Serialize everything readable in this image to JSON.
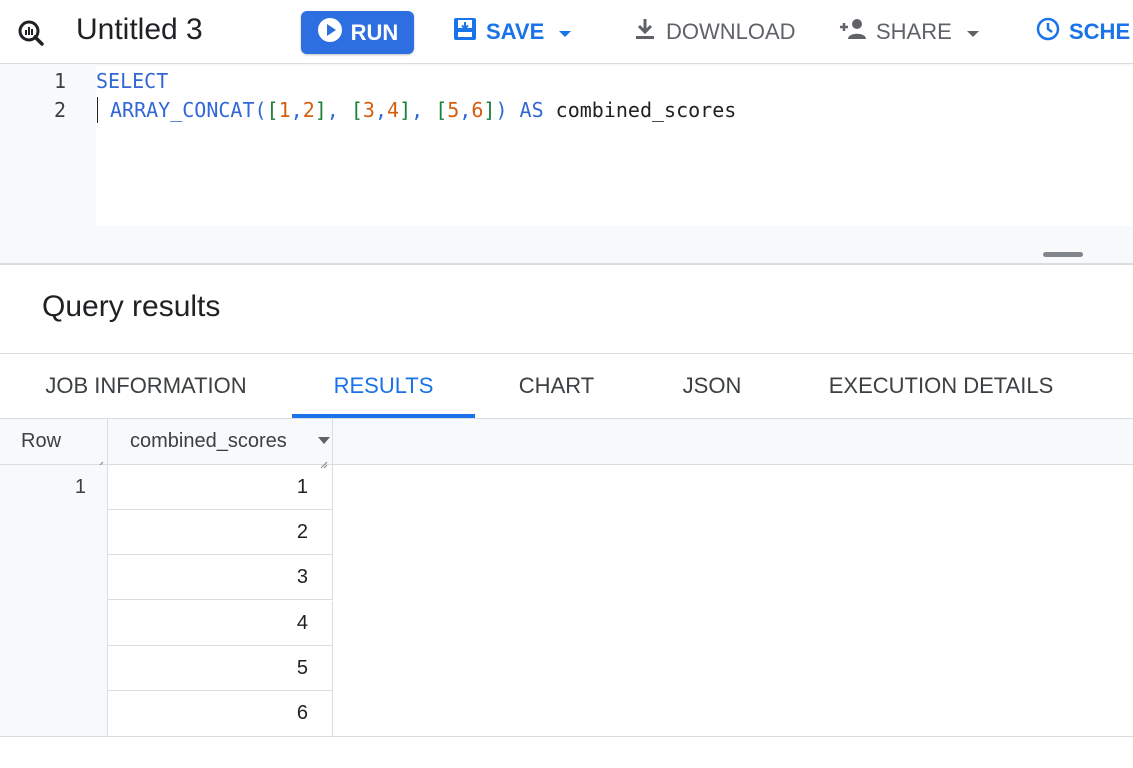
{
  "toolbar": {
    "title": "Untitled 3",
    "run_label": "RUN",
    "save_label": "SAVE",
    "download_label": "DOWNLOAD",
    "share_label": "SHARE",
    "schedule_label": "SCHE",
    "icons": [
      "query-icon",
      "play-icon",
      "save-icon",
      "chevron-down-icon",
      "download-icon",
      "add-person-icon",
      "clock-icon"
    ]
  },
  "editor": {
    "lines": [
      {
        "number": "1",
        "tokens": [
          {
            "t": "SELECT",
            "c": "kw"
          }
        ]
      },
      {
        "number": "2",
        "tokens": [
          {
            "t": "ARRAY_CONCAT",
            "c": "fn"
          },
          {
            "t": "(",
            "c": "kw"
          },
          {
            "t": "[",
            "c": "br"
          },
          {
            "t": "1",
            "c": "num"
          },
          {
            "t": ",",
            "c": "kw"
          },
          {
            "t": "2",
            "c": "num"
          },
          {
            "t": "]",
            "c": "br"
          },
          {
            "t": ", ",
            "c": "kw"
          },
          {
            "t": "[",
            "c": "br"
          },
          {
            "t": "3",
            "c": "num"
          },
          {
            "t": ",",
            "c": "kw"
          },
          {
            "t": "4",
            "c": "num"
          },
          {
            "t": "]",
            "c": "br"
          },
          {
            "t": ", ",
            "c": "kw"
          },
          {
            "t": "[",
            "c": "br"
          },
          {
            "t": "5",
            "c": "num"
          },
          {
            "t": ",",
            "c": "kw"
          },
          {
            "t": "6",
            "c": "num"
          },
          {
            "t": "]",
            "c": "br"
          },
          {
            "t": ")",
            "c": "kw"
          },
          {
            "t": " AS ",
            "c": "kw"
          },
          {
            "t": "combined_scores",
            "c": "pl"
          }
        ]
      }
    ]
  },
  "results": {
    "title": "Query results",
    "tabs": [
      {
        "label": "JOB INFORMATION",
        "active": false
      },
      {
        "label": "RESULTS",
        "active": true
      },
      {
        "label": "CHART",
        "active": false
      },
      {
        "label": "JSON",
        "active": false
      },
      {
        "label": "EXECUTION DETAILS",
        "active": false
      }
    ],
    "table": {
      "row_header": "Row",
      "column_header": "combined_scores",
      "row_number": "1",
      "values": [
        "1",
        "2",
        "3",
        "4",
        "5",
        "6"
      ]
    }
  },
  "colors": {
    "accent": "#1a73e8",
    "run_button": "#2d6fe0",
    "keyword": "#3367d6",
    "number": "#d65d0e",
    "bracket": "#188038"
  }
}
